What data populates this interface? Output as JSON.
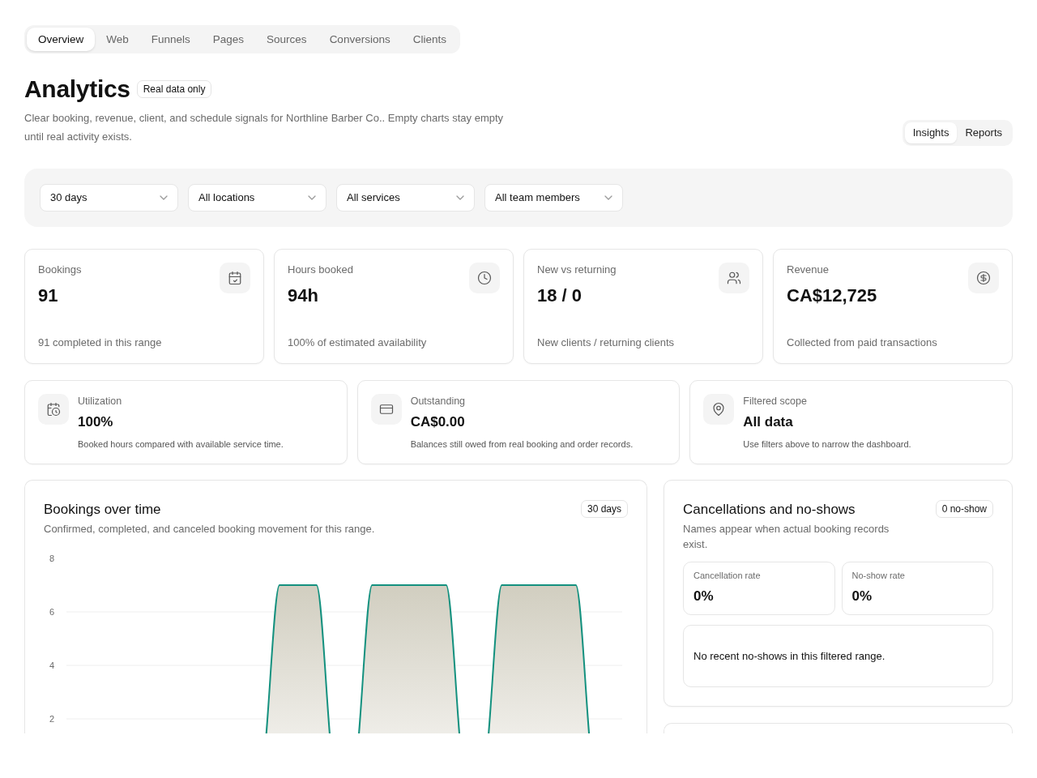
{
  "tabs": [
    {
      "label": "Overview",
      "selected": true
    },
    {
      "label": "Web",
      "selected": false
    },
    {
      "label": "Funnels",
      "selected": false
    },
    {
      "label": "Pages",
      "selected": false
    },
    {
      "label": "Sources",
      "selected": false
    },
    {
      "label": "Conversions",
      "selected": false
    },
    {
      "label": "Clients",
      "selected": false
    }
  ],
  "header": {
    "title": "Analytics",
    "badge": "Real data only",
    "description": "Clear booking, revenue, client, and schedule signals for Northline Barber Co.. Empty charts stay empty until real activity exists."
  },
  "view_toggle": [
    {
      "label": "Insights",
      "selected": true
    },
    {
      "label": "Reports",
      "selected": false
    }
  ],
  "filters": [
    {
      "value": "30 days"
    },
    {
      "value": "All locations"
    },
    {
      "value": "All services"
    },
    {
      "value": "All team members"
    }
  ],
  "kpis": [
    {
      "label": "Bookings",
      "value": "91",
      "note": "91 completed in this range"
    },
    {
      "label": "Hours booked",
      "value": "94h",
      "note": "100% of estimated availability"
    },
    {
      "label": "New vs returning",
      "value": "18 / 0",
      "note": "New clients / returning clients"
    },
    {
      "label": "Revenue",
      "value": "CA$12,725",
      "note": "Collected from paid transactions"
    }
  ],
  "summary_cards": [
    {
      "label": "Utilization",
      "value": "100%",
      "note": "Booked hours compared with available service time."
    },
    {
      "label": "Outstanding",
      "value": "CA$0.00",
      "note": "Balances still owed from real booking and order records."
    },
    {
      "label": "Filtered scope",
      "value": "All data",
      "note": "Use filters above to narrow the dashboard."
    }
  ],
  "bookings_chart": {
    "title": "Bookings over time",
    "subtitle": "Confirmed, completed, and canceled booking movement for this range.",
    "badge": "30 days",
    "chart_data": {
      "type": "area",
      "grid": true,
      "ylim": [
        0,
        8
      ],
      "yticks": [
        2,
        4,
        6,
        8
      ],
      "values": [
        0,
        0,
        0,
        0,
        0,
        0,
        0,
        0,
        0,
        0,
        0,
        7,
        7,
        7,
        0,
        0,
        7,
        7,
        7,
        7,
        7,
        0,
        0,
        7,
        7,
        7,
        7,
        7,
        0,
        0
      ]
    }
  },
  "cancellations": {
    "title": "Cancellations and no-shows",
    "badge": "0 no-show",
    "description": "Names appear when actual booking records exist.",
    "stats": [
      {
        "label": "Cancellation rate",
        "value": "0%"
      },
      {
        "label": "No-show rate",
        "value": "0%"
      }
    ],
    "empty_message": "No recent no-shows in this filtered range."
  }
}
